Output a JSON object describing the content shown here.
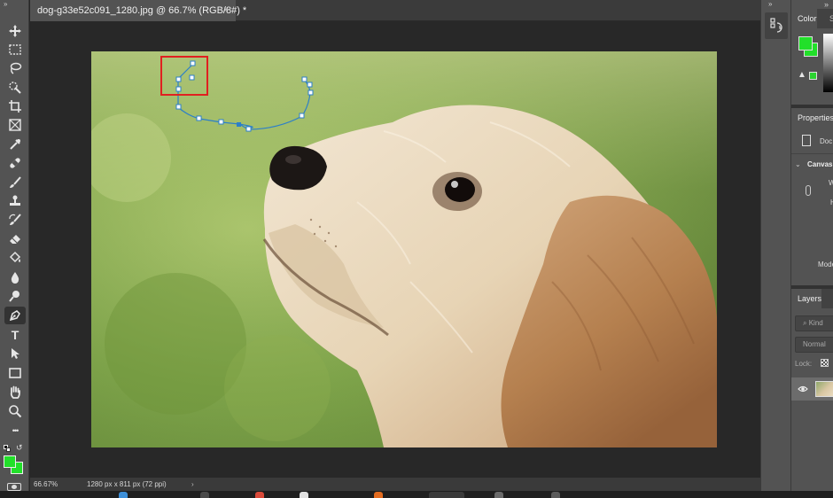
{
  "document": {
    "tab_title": "dog-g33e52c091_1280.jpg @ 66.7% (RGB/8#) *",
    "close_glyph": "×"
  },
  "toolbar": {
    "collapse_glyph": "»",
    "tools": [
      {
        "name": "move-tool",
        "icon": "move-icon",
        "active": false
      },
      {
        "name": "marquee-tool",
        "icon": "marquee-icon",
        "active": false
      },
      {
        "name": "lasso-tool",
        "icon": "lasso-icon",
        "active": false
      },
      {
        "name": "quick-selection-tool",
        "icon": "quick-select-icon",
        "active": false
      },
      {
        "name": "crop-tool",
        "icon": "crop-icon",
        "active": false
      },
      {
        "name": "frame-tool",
        "icon": "frame-icon",
        "active": false
      },
      {
        "name": "eyedropper-tool",
        "icon": "eyedropper-icon",
        "active": false
      },
      {
        "name": "healing-brush-tool",
        "icon": "bandage-icon",
        "active": false
      },
      {
        "name": "brush-tool",
        "icon": "brush-icon",
        "active": false
      },
      {
        "name": "clone-stamp-tool",
        "icon": "stamp-icon",
        "active": false
      },
      {
        "name": "history-brush-tool",
        "icon": "history-brush-icon",
        "active": false
      },
      {
        "name": "eraser-tool",
        "icon": "eraser-icon",
        "active": false
      },
      {
        "name": "paint-bucket-tool",
        "icon": "paint-bucket-icon",
        "active": false
      },
      {
        "name": "blur-tool",
        "icon": "drop-icon",
        "active": false
      },
      {
        "name": "dodge-tool",
        "icon": "dodge-icon",
        "active": false
      },
      {
        "name": "pen-tool",
        "icon": "pen-icon",
        "active": true
      },
      {
        "name": "type-tool",
        "icon": "type-icon",
        "active": false
      },
      {
        "name": "path-selection-tool",
        "icon": "arrow-icon",
        "active": false
      },
      {
        "name": "rectangle-tool",
        "icon": "rectangle-icon",
        "active": false
      },
      {
        "name": "hand-tool",
        "icon": "hand-icon",
        "active": false
      },
      {
        "name": "zoom-tool",
        "icon": "zoom-icon",
        "active": false
      },
      {
        "name": "more-tools",
        "icon": "ellipsis-icon",
        "active": false
      }
    ],
    "type_glyph": "T",
    "more_glyph": "•••",
    "foreground_color": "#22e02a",
    "background_color": "#22e02a"
  },
  "status": {
    "zoom": "66.67%",
    "doc_info": "1280 px x 811 px (72 ppi)",
    "arrow": "›"
  },
  "right_panel": {
    "collapse_glyph": "»",
    "close_glyph": "»  ×",
    "color_tab": "Color",
    "swatches_tab_clip": "S",
    "warning_glyph": "▲",
    "properties_tab": "Properties",
    "doc_label_clip": "Doc",
    "canvas_section": "Canvas",
    "w_label_clip": "W",
    "h_label_clip": "H",
    "mode_label_clip": "Mode",
    "layers_tab": "Layers",
    "kind_placeholder": "Kind",
    "blend_mode": "Normal",
    "lock_label": "Lock:",
    "eye_glyph": "👁"
  },
  "colors": {
    "accent_selection": "#e02020",
    "path_stroke": "#2c7fc9"
  }
}
